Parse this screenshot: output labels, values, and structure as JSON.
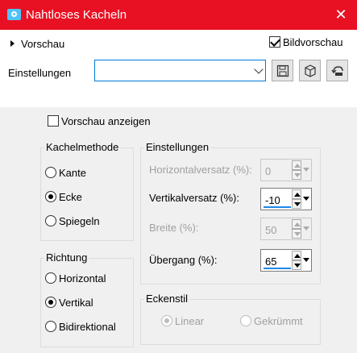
{
  "window": {
    "title": "Nahtloses Kacheln",
    "close_glyph": "✕"
  },
  "topbar": {
    "preview_label": "Vorschau",
    "bildvorschau_label": "Bildvorschau",
    "bildvorschau_checked": true,
    "settings_label": "Einstellungen",
    "preset_value": ""
  },
  "options": {
    "show_preview_label": "Vorschau anzeigen",
    "show_preview_checked": false
  },
  "tile_method": {
    "title": "Kachelmethode",
    "items": [
      {
        "label": "Kante",
        "checked": false
      },
      {
        "label": "Ecke",
        "checked": true
      },
      {
        "label": "Spiegeln",
        "checked": false
      }
    ]
  },
  "direction": {
    "title": "Richtung",
    "items": [
      {
        "label": "Horizontal",
        "checked": false
      },
      {
        "label": "Vertikal",
        "checked": true
      },
      {
        "label": "Bidirektional",
        "checked": false
      }
    ]
  },
  "settings": {
    "title": "Einstellungen",
    "fields": [
      {
        "label": "Horizontalversatz (%):",
        "value": "0",
        "enabled": false
      },
      {
        "label": "Vertikalversatz (%):",
        "value": "-10",
        "enabled": true
      },
      {
        "label": "Breite (%):",
        "value": "50",
        "enabled": false
      },
      {
        "label": "Übergang (%):",
        "value": "65",
        "enabled": true
      }
    ]
  },
  "corner_style": {
    "title": "Eckenstil",
    "items": [
      {
        "label": "Linear",
        "checked": true,
        "enabled": false
      },
      {
        "label": "Gekrümmt",
        "checked": false,
        "enabled": false
      }
    ]
  },
  "colors": {
    "titlebar": "#e81123",
    "accent": "#1e88e5",
    "window_bg": "#f0f0f0"
  },
  "icons": [
    "camera-icon",
    "close-icon",
    "save-icon",
    "cube-icon",
    "reset-icon"
  ]
}
